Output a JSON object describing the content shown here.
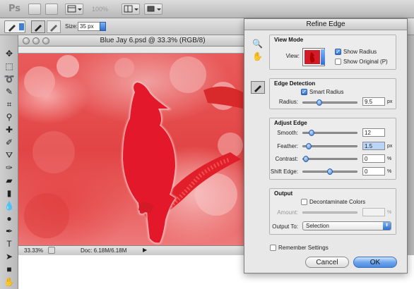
{
  "menubar": {
    "logo": "Ps",
    "zoom": "100%"
  },
  "options": {
    "size_label": "Size:",
    "size_value": "35 px"
  },
  "document": {
    "title": "Blue Jay 6.psd @ 33.3% (RGB/8)",
    "zoom_level": "33.33%",
    "doc_size": "Doc: 6.18M/6.18M"
  },
  "dialog": {
    "title": "Refine Edge",
    "view_mode": {
      "heading": "View Mode",
      "view_label": "View:",
      "show_radius": "Show Radius",
      "show_original": "Show Original (P)"
    },
    "edge_detection": {
      "heading": "Edge Detection",
      "smart_radius": "Smart Radius",
      "radius_label": "Radius:",
      "radius_value": "9.5",
      "radius_unit": "px",
      "radius_level": 0.28
    },
    "adjust_edge": {
      "heading": "Adjust Edge",
      "smooth_label": "Smooth:",
      "smooth_value": "12",
      "smooth_level": 0.12,
      "feather_label": "Feather:",
      "feather_value": "1.5",
      "feather_unit": "px",
      "feather_level": 0.06,
      "contrast_label": "Contrast:",
      "contrast_value": "0",
      "contrast_unit": "%",
      "contrast_level": 0.0,
      "shift_label": "Shift Edge:",
      "shift_value": "0",
      "shift_unit": "%",
      "shift_level": 0.5
    },
    "output": {
      "heading": "Output",
      "decontaminate": "Decontaminate Colors",
      "amount_label": "Amount:",
      "amount_unit": "%",
      "output_to_label": "Output To:",
      "output_to_value": "Selection"
    },
    "remember": "Remember Settings",
    "cancel": "Cancel",
    "ok": "OK"
  }
}
